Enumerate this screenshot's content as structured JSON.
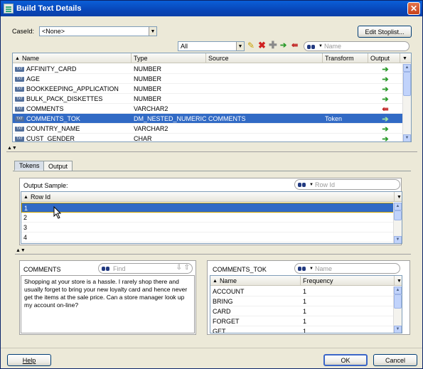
{
  "window": {
    "title": "Build Text Details"
  },
  "caseid": {
    "label": "CaseId:",
    "value": "<None>"
  },
  "edit_stoplist_label": "Edit Stoplist...",
  "toolbar": {
    "filter_value": "All",
    "name_placeholder": "Name"
  },
  "attributes": {
    "columns": [
      "Name",
      "Type",
      "Source",
      "Transform",
      "Output"
    ],
    "rows": [
      {
        "name": "AFFINITY_CARD",
        "type": "NUMBER",
        "source": "",
        "transform": "",
        "output": "green-arrow"
      },
      {
        "name": "AGE",
        "type": "NUMBER",
        "source": "",
        "transform": "",
        "output": "green-arrow"
      },
      {
        "name": "BOOKKEEPING_APPLICATION",
        "type": "NUMBER",
        "source": "",
        "transform": "",
        "output": "green-arrow"
      },
      {
        "name": "BULK_PACK_DISKETTES",
        "type": "NUMBER",
        "source": "",
        "transform": "",
        "output": "green-arrow"
      },
      {
        "name": "COMMENTS",
        "type": "VARCHAR2",
        "source": "",
        "transform": "",
        "output": "red-arrow"
      },
      {
        "name": "COMMENTS_TOK",
        "type": "DM_NESTED_NUMERICALS",
        "source": "COMMENTS",
        "transform": "Token",
        "output": "green-arrow"
      },
      {
        "name": "COUNTRY_NAME",
        "type": "VARCHAR2",
        "source": "",
        "transform": "",
        "output": "green-arrow"
      },
      {
        "name": "CUST_GENDER",
        "type": "CHAR",
        "source": "",
        "transform": "",
        "output": "green-arrow"
      }
    ],
    "selected_index": 5,
    "type_badge": "TXT"
  },
  "tabs": [
    "Tokens",
    "Output"
  ],
  "output_sample": {
    "label": "Output Sample:",
    "search_placeholder": "Row Id",
    "column": "Row Id",
    "rows": [
      "1",
      "2",
      "3",
      "4"
    ]
  },
  "comments": {
    "label": "COMMENTS",
    "find_placeholder": "Find",
    "text": "Shopping at your store is a hassle. I rarely shop there and usually forget to bring your new loyalty card and hence never get the items at the sale price.  Can a store manager look up my account on-line?"
  },
  "tokens": {
    "label": "COMMENTS_TOK",
    "search_placeholder": "Name",
    "columns": [
      "Name",
      "Frequency"
    ],
    "rows": [
      {
        "name": "ACCOUNT",
        "freq": "1"
      },
      {
        "name": "BRING",
        "freq": "1"
      },
      {
        "name": "CARD",
        "freq": "1"
      },
      {
        "name": "FORGET",
        "freq": "1"
      },
      {
        "name": "GET",
        "freq": "1"
      }
    ]
  },
  "footer": {
    "help_label": "Help",
    "ok_label": "OK",
    "cancel_label": "Cancel"
  }
}
